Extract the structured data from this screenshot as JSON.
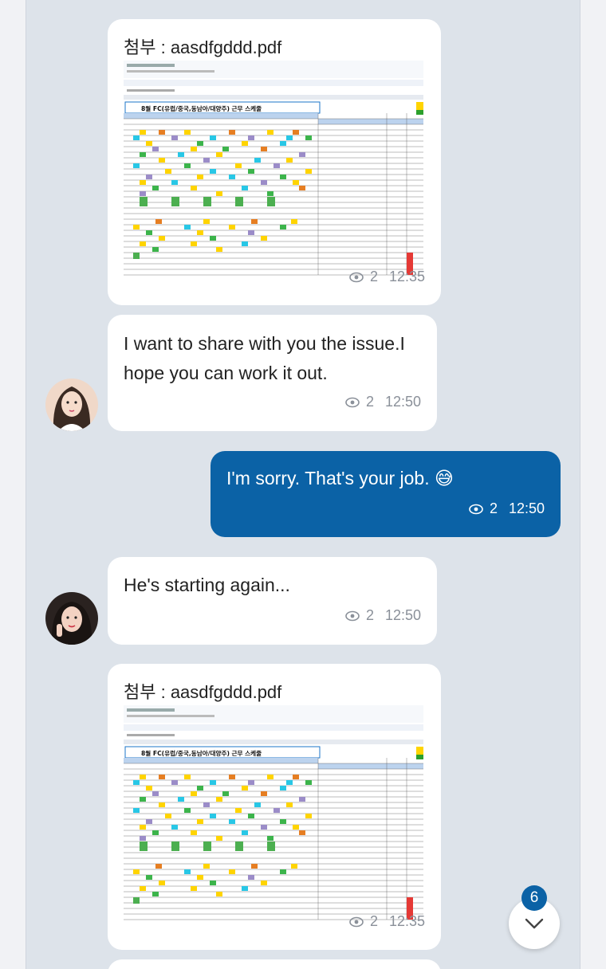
{
  "messages": [
    {
      "type": "attachment",
      "label": "첨부 : aasdfgddd.pdf",
      "doc_title": "8월 FC(유럽/중국,동남아/대양주) 근무 스케줄",
      "read": "2",
      "time": "12:35"
    },
    {
      "type": "text",
      "text": "I want to share with you the issue.I hope you can work it out.",
      "read": "2",
      "time": "12:50"
    },
    {
      "type": "text",
      "mine": true,
      "text": "I'm sorry. That's your job. 😅",
      "read": "2",
      "time": "12:50"
    },
    {
      "type": "text",
      "text": "He's starting again...",
      "read": "2",
      "time": "12:50"
    },
    {
      "type": "attachment",
      "label": "첨부 : aasdfgddd.pdf",
      "doc_title": "8월 FC(유럽/중국,동남아/대양주) 근무 스케줄",
      "read": "2",
      "time": "12:35"
    }
  ],
  "unread_badge": "6",
  "colors": {
    "chat_bg": "#dde3ea",
    "my_bubble": "#0b62a6",
    "badge": "#0b62a6"
  }
}
